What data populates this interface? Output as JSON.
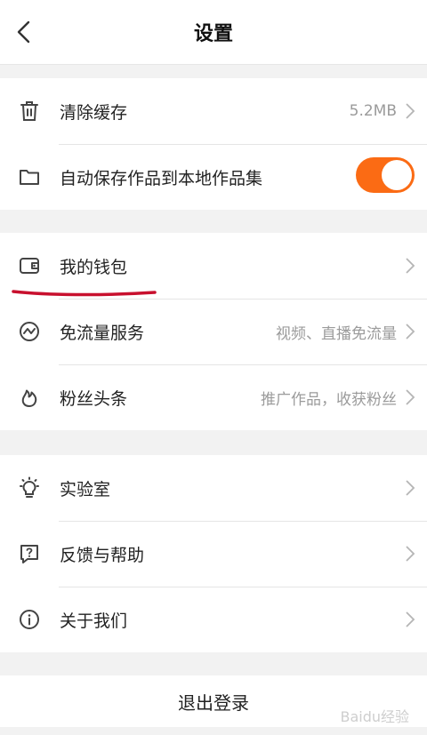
{
  "header": {
    "title": "设置"
  },
  "group1": {
    "clear_cache": {
      "label": "清除缓存",
      "value": "5.2MB"
    },
    "auto_save": {
      "label": "自动保存作品到本地作品集",
      "toggle_on": true
    }
  },
  "group2": {
    "wallet": {
      "label": "我的钱包"
    },
    "free_data": {
      "label": "免流量服务",
      "value": "视频、直播免流量"
    },
    "fan_headline": {
      "label": "粉丝头条",
      "value": "推广作品，收获粉丝"
    }
  },
  "group3": {
    "lab": {
      "label": "实验室"
    },
    "feedback": {
      "label": "反馈与帮助"
    },
    "about": {
      "label": "关于我们"
    }
  },
  "logout": {
    "label": "退出登录"
  },
  "watermark": "Baidu经验",
  "colors": {
    "accent": "#fb6b14",
    "annotation": "#c8102e"
  }
}
